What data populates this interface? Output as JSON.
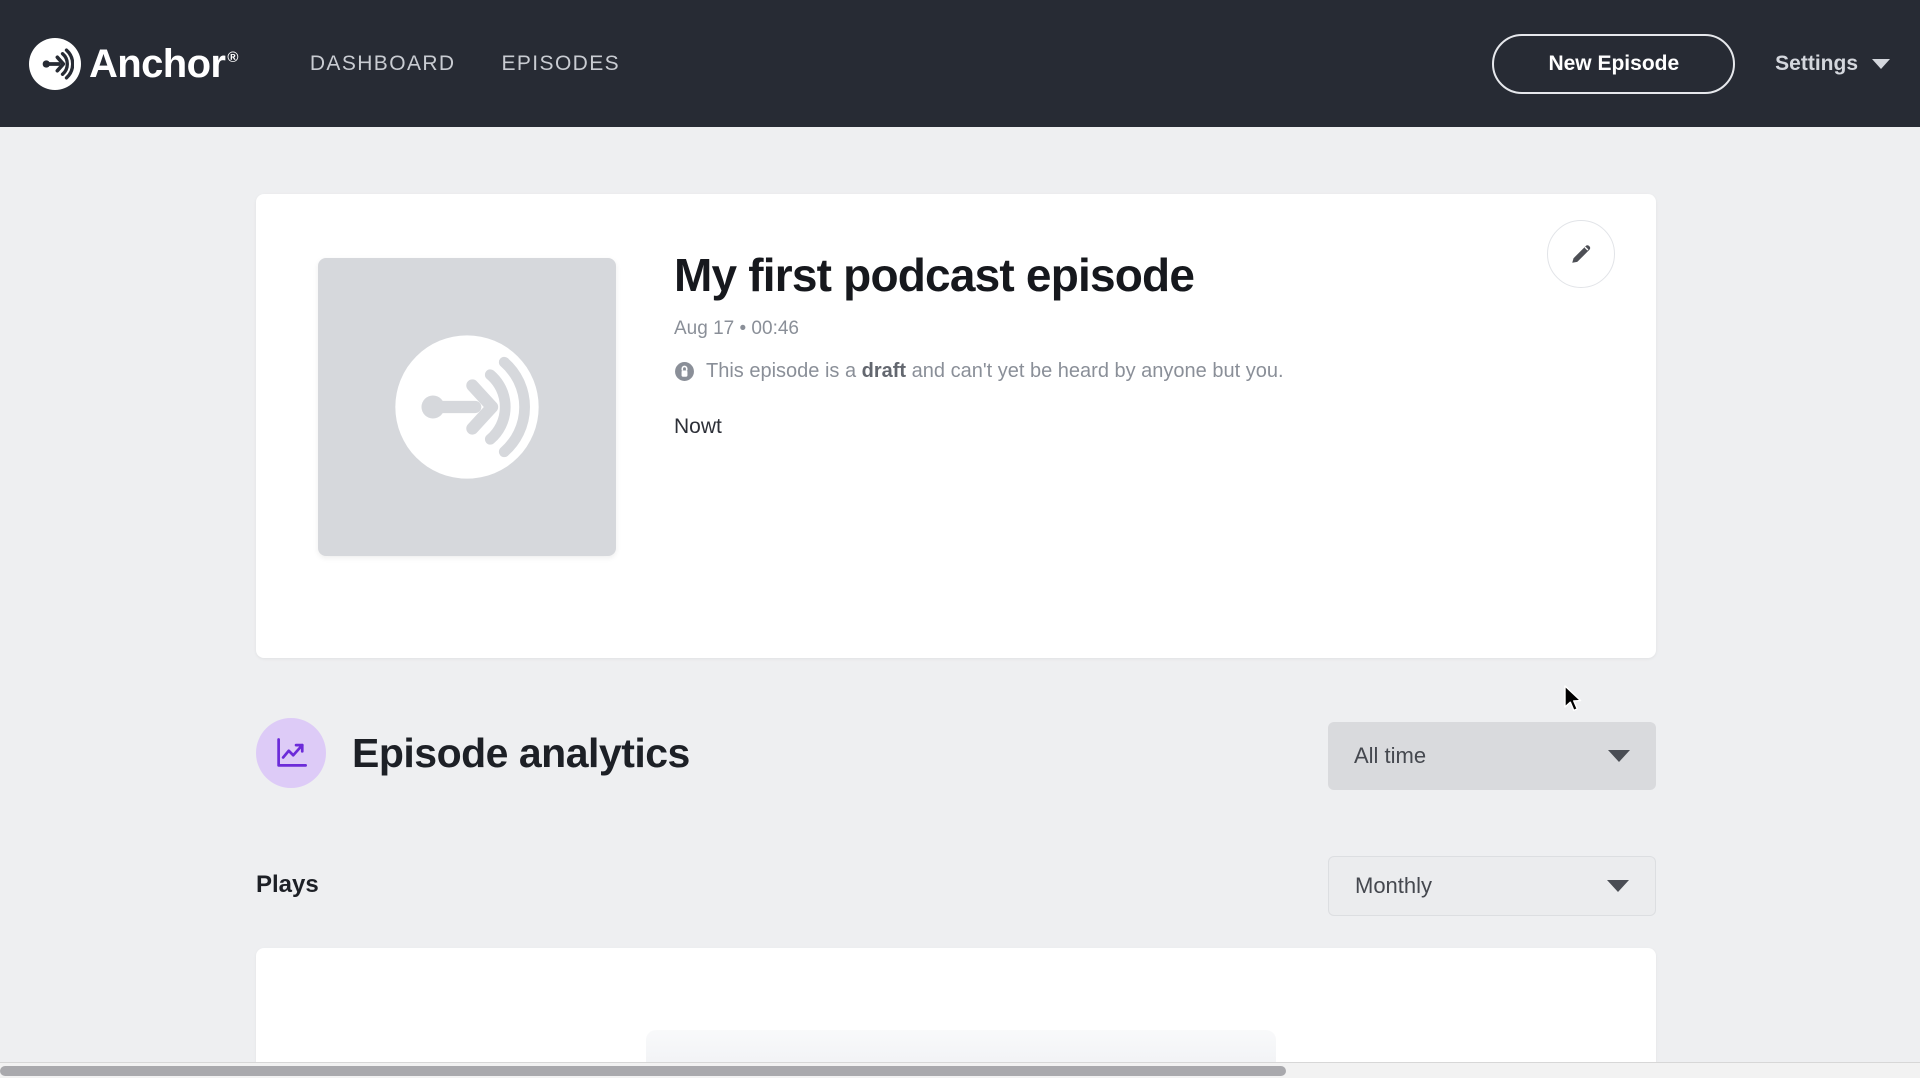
{
  "header": {
    "brand": {
      "name": "Anchor",
      "registered": "®",
      "logo_icon": "anchor-broadcast-icon"
    },
    "nav": [
      {
        "label": "DASHBOARD",
        "name": "dashboard"
      },
      {
        "label": "EPISODES",
        "name": "episodes"
      }
    ],
    "new_episode_label": "New Episode",
    "settings_label": "Settings",
    "settings_caret_icon": "chevron-down-icon",
    "background_color": "#272b34",
    "text_color": "#c9ccd2"
  },
  "episode": {
    "title": "My first podcast episode",
    "meta": "Aug 17 • 00:46",
    "draft_prefix": "This episode is a ",
    "draft_word": "draft",
    "draft_suffix": " and can't yet be heard by anyone but you.",
    "lock_icon": "lock-icon",
    "description": "Nowt",
    "cover_icon": "anchor-broadcast-icon",
    "edit_icon": "pencil-icon",
    "cover_color": "#d6d8dc"
  },
  "analytics": {
    "title": "Episode analytics",
    "icon": "line-chart-up-icon",
    "icon_bg_color": "#ddcbf7",
    "icon_color": "#6c2bd9",
    "range_select": {
      "value": "All time",
      "caret_icon": "chevron-down-icon"
    },
    "plays_label": "Plays",
    "interval_select": {
      "value": "Monthly",
      "caret_icon": "chevron-down-icon"
    }
  },
  "chart_data": {
    "type": "bar",
    "title": "Plays",
    "categories": [],
    "values": [],
    "xlabel": "",
    "ylabel": "",
    "note": "Chart panel is cut off at the bottom edge of the viewport; no data points are visible."
  },
  "colors": {
    "page_background": "#eeeff1",
    "card_background": "#ffffff",
    "accent_purple": "#6c2bd9"
  }
}
